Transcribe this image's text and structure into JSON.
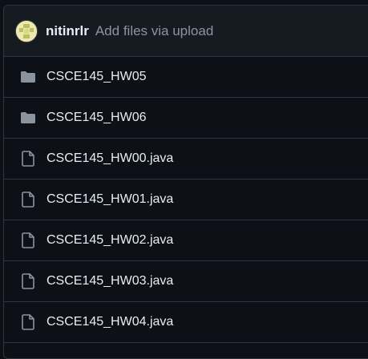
{
  "commit": {
    "author": "nitinrlr",
    "message": "Add files via upload"
  },
  "files": [
    {
      "name": "CSCE145_HW05",
      "type": "folder",
      "icon": "folder-icon"
    },
    {
      "name": "CSCE145_HW06",
      "type": "folder",
      "icon": "folder-icon"
    },
    {
      "name": "CSCE145_HW00.java",
      "type": "file",
      "icon": "file-icon"
    },
    {
      "name": "CSCE145_HW01.java",
      "type": "file",
      "icon": "file-icon"
    },
    {
      "name": "CSCE145_HW02.java",
      "type": "file",
      "icon": "file-icon"
    },
    {
      "name": "CSCE145_HW03.java",
      "type": "file",
      "icon": "file-icon"
    },
    {
      "name": "CSCE145_HW04.java",
      "type": "file",
      "icon": "file-icon"
    }
  ],
  "colors": {
    "background": "#0d1117",
    "header_background": "#161b22",
    "border": "#30363d",
    "text": "#e6edf3",
    "muted_text": "#8b949e",
    "icon": "#8b949e"
  }
}
